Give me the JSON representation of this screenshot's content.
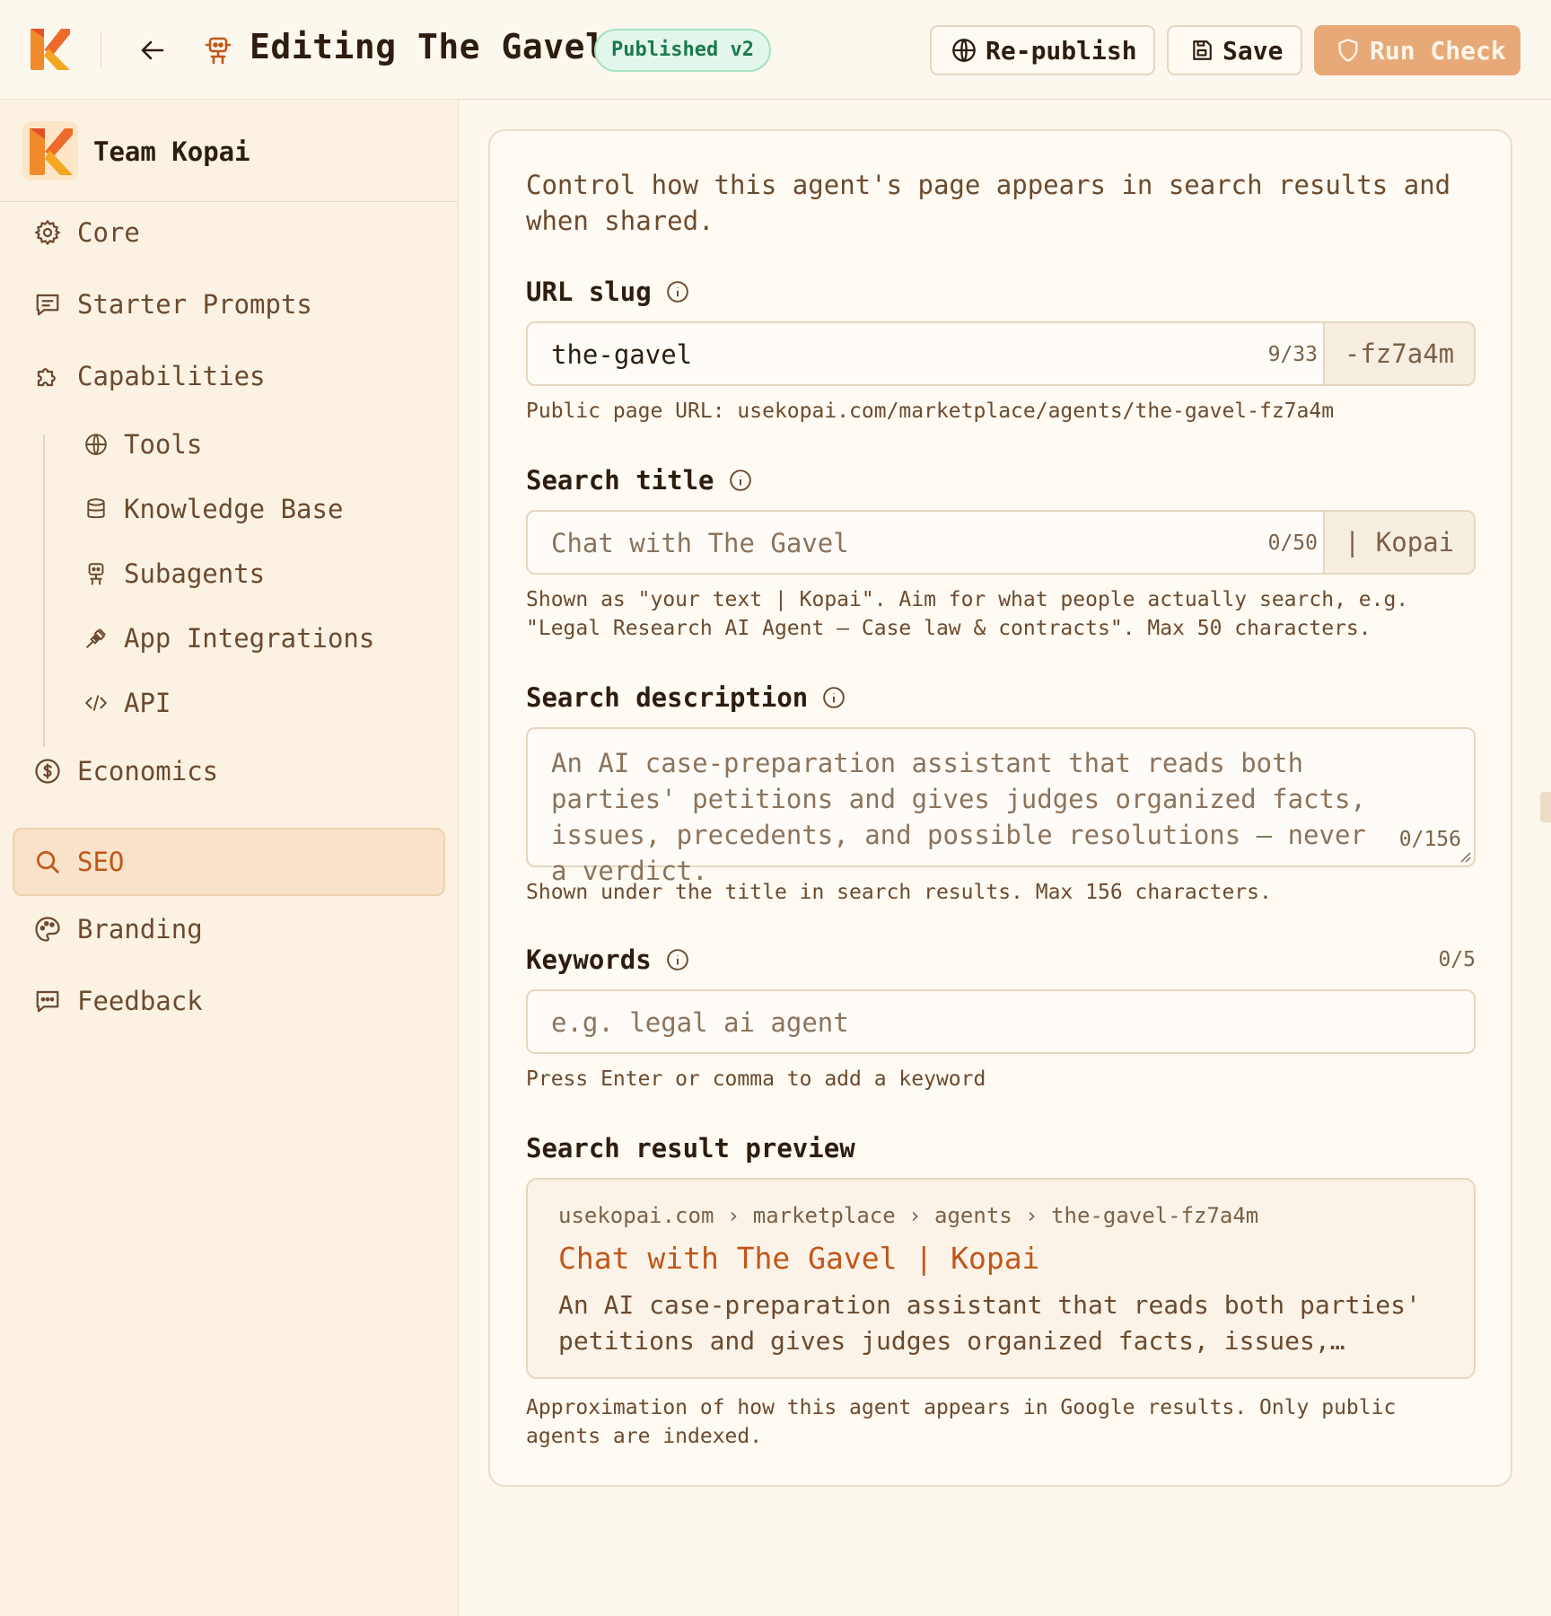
{
  "header": {
    "title": "Editing The Gavel",
    "status_badge": "Published v2",
    "republish_label": "Re-publish",
    "save_label": "Save",
    "run_check_label": "Run Check"
  },
  "sidebar": {
    "team_name": "Team Kopai",
    "items": [
      {
        "label": "Core",
        "icon": "gear-icon"
      },
      {
        "label": "Starter Prompts",
        "icon": "message-icon"
      },
      {
        "label": "Capabilities",
        "icon": "puzzle-icon"
      },
      {
        "label": "Tools",
        "icon": "globe-icon"
      },
      {
        "label": "Knowledge Base",
        "icon": "database-icon"
      },
      {
        "label": "Subagents",
        "icon": "robot-icon"
      },
      {
        "label": "App Integrations",
        "icon": "plug-icon"
      },
      {
        "label": "API",
        "icon": "code-icon"
      },
      {
        "label": "Economics",
        "icon": "dollar-icon"
      },
      {
        "label": "SEO",
        "icon": "search-icon",
        "active": true
      },
      {
        "label": "Branding",
        "icon": "palette-icon"
      },
      {
        "label": "Feedback",
        "icon": "chat-icon"
      }
    ]
  },
  "seo": {
    "intro": "Control how this agent's page appears in search results and when shared.",
    "url_slug": {
      "label": "URL slug",
      "value": "the-gavel",
      "counter": "9/33",
      "suffix": "-fz7a4m",
      "hint": "Public page URL: usekopai.com/marketplace/agents/the-gavel-fz7a4m"
    },
    "search_title": {
      "label": "Search title",
      "placeholder": "Chat with The Gavel",
      "counter": "0/50",
      "suffix": "| Kopai",
      "hint_line1": "Shown as \"your text | Kopai\". Aim for what people actually search, e.g.",
      "hint_line2": "\"Legal Research AI Agent — Case law & contracts\". Max 50 characters."
    },
    "search_description": {
      "label": "Search description",
      "placeholder": "An AI case-preparation assistant that reads both parties' petitions and gives judges organized facts, issues, precedents, and possible resolutions — never a verdict.",
      "counter": "0/156",
      "hint": "Shown under the title in search results. Max 156 characters."
    },
    "keywords": {
      "label": "Keywords",
      "counter": "0/5",
      "placeholder": "e.g. legal ai agent",
      "hint": "Press Enter or comma to add a keyword"
    },
    "preview": {
      "label": "Search result preview",
      "breadcrumb": "usekopai.com › marketplace › agents › the-gavel-fz7a4m",
      "title": "Chat with The Gavel | Kopai",
      "description": "An AI case-preparation assistant that reads both parties' petitions and gives judges organized facts, issues,…",
      "hint_line1": "Approximation of how this agent appears in Google results. Only public",
      "hint_line2": "agents are indexed."
    }
  },
  "colors": {
    "accent": "#c2571b",
    "background": "#fdf8ee",
    "badge_green": "#1b7a4c",
    "run_check": "#e7a977"
  }
}
